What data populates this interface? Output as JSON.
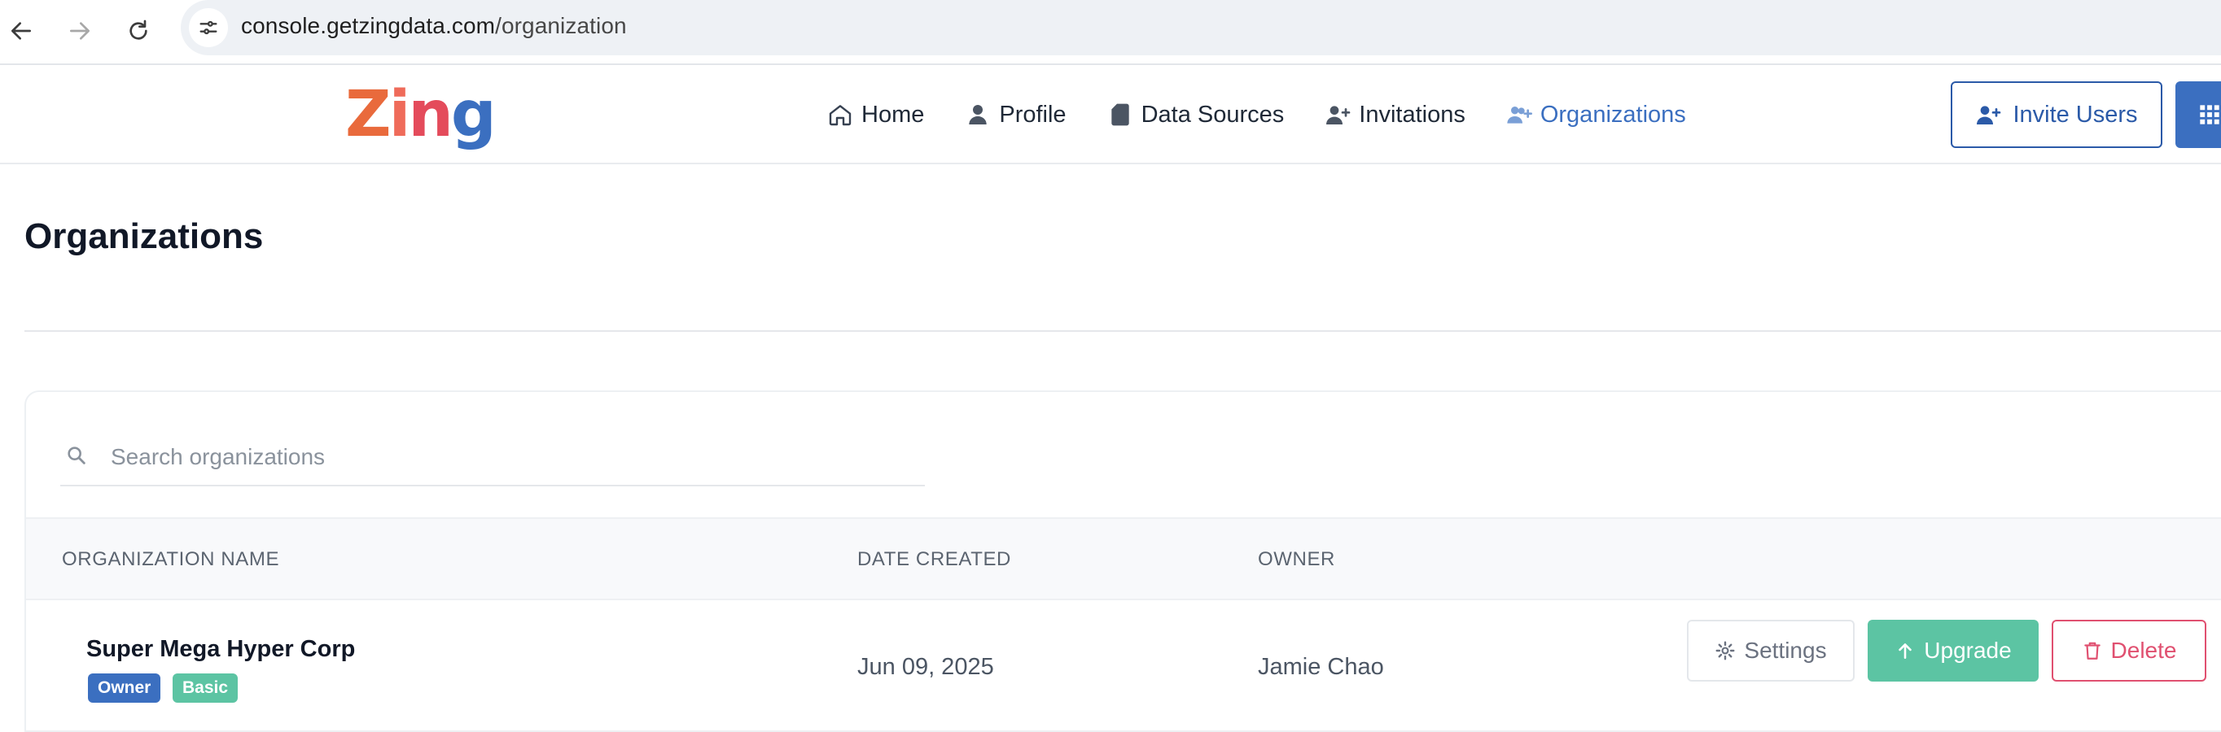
{
  "browser": {
    "url_domain": "console.getzingdata.com",
    "url_path": "/organization"
  },
  "header": {
    "logo_text": "Zing",
    "nav": [
      {
        "label": "Home",
        "icon": "home-icon"
      },
      {
        "label": "Profile",
        "icon": "user-icon"
      },
      {
        "label": "Data Sources",
        "icon": "file-icon"
      },
      {
        "label": "Invitations",
        "icon": "user-plus-icon"
      },
      {
        "label": "Organizations",
        "icon": "users-plus-icon",
        "active": true
      }
    ],
    "invite_label": "Invite Users"
  },
  "page": {
    "title": "Organizations"
  },
  "search": {
    "placeholder": "Search organizations"
  },
  "table": {
    "headers": [
      "ORGANIZATION NAME",
      "DATE CREATED",
      "OWNER"
    ],
    "rows": [
      {
        "name": "Super Mega Hyper Corp",
        "role_badge": "Owner",
        "plan_badge": "Basic",
        "date_created": "Jun 09, 2025",
        "owner": "Jamie Chao",
        "actions": {
          "settings": "Settings",
          "upgrade": "Upgrade",
          "delete": "Delete"
        }
      }
    ]
  },
  "colors": {
    "brand_blue": "#3b6fc0",
    "upgrade_green": "#5cc4a3",
    "delete_red": "#e05070"
  }
}
